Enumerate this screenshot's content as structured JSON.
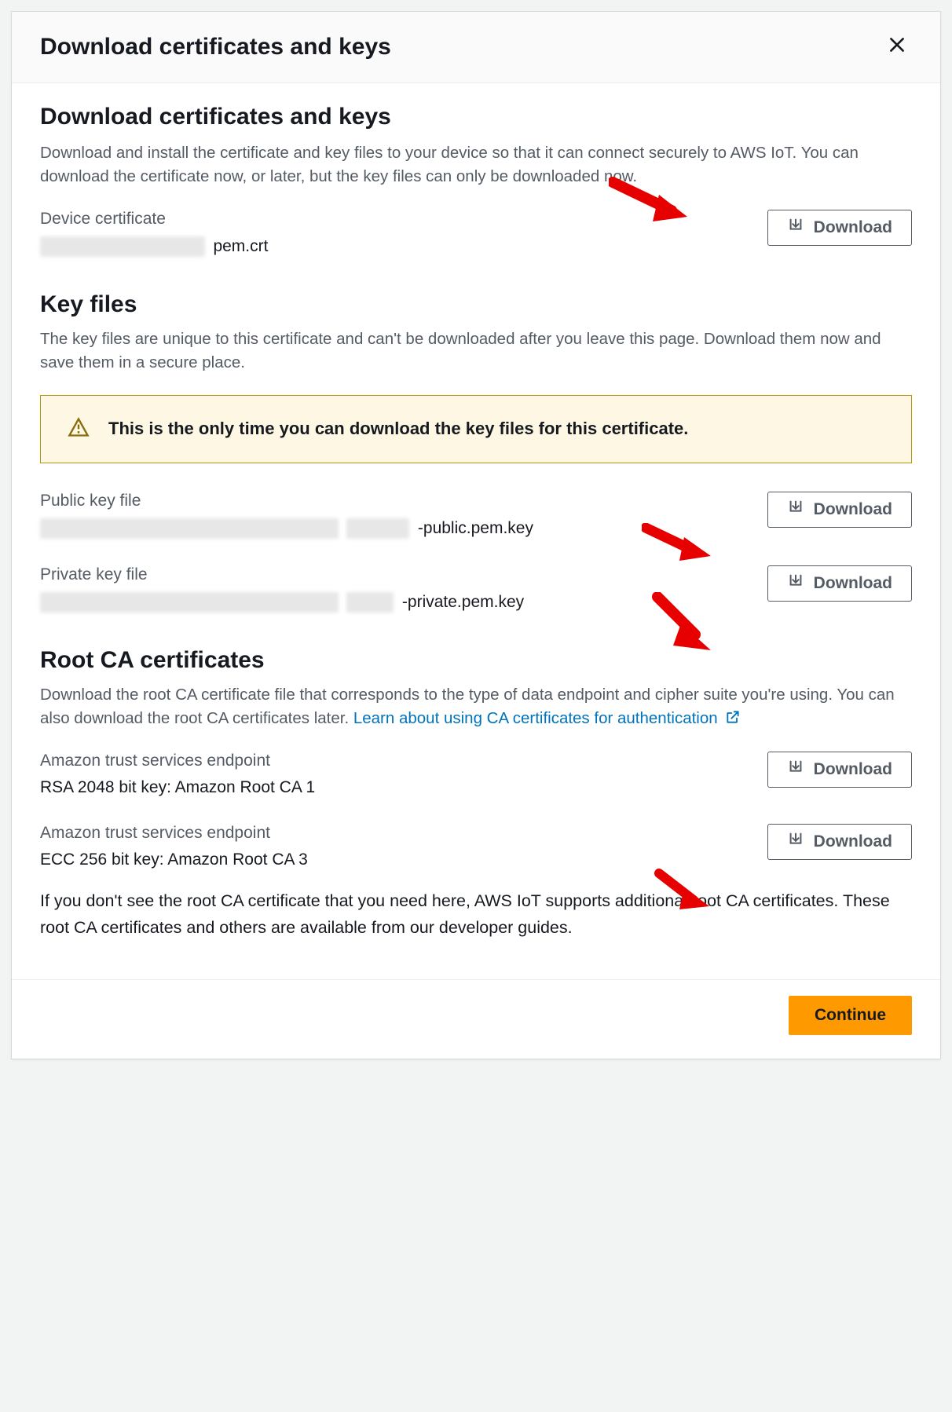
{
  "modal": {
    "title": "Download certificates and keys"
  },
  "section1": {
    "title": "Download certificates and keys",
    "desc": "Download and install the certificate and key files to your device so that it can connect securely to AWS IoT. You can download the certificate now, or later, but the key files can only be downloaded now.",
    "device_cert_label": "Device certificate",
    "device_cert_suffix": "pem.crt",
    "download_btn": "Download"
  },
  "section2": {
    "title": "Key files",
    "desc": "The key files are unique to this certificate and can't be downloaded after you leave this page. Download them now and save them in a secure place.",
    "alert": "This is the only time you can download the key files for this certificate.",
    "public_label": "Public key file",
    "public_suffix": "-public.pem.key",
    "private_label": "Private key file",
    "private_suffix": "-private.pem.key",
    "download_btn": "Download"
  },
  "section3": {
    "title": "Root CA certificates",
    "desc_pre": "Download the root CA certificate file that corresponds to the type of data endpoint and cipher suite you're using. You can also download the root CA certificates later. ",
    "link_text": "Learn about using CA certificates for authentication",
    "ca1_label": "Amazon trust services endpoint",
    "ca1_value": "RSA 2048 bit key: Amazon Root CA 1",
    "ca2_label": "Amazon trust services endpoint",
    "ca2_value": "ECC 256 bit key: Amazon Root CA 3",
    "download_btn": "Download",
    "footnote": "If you don't see the root CA certificate that you need here, AWS IoT supports additional root CA certificates. These root CA certificates and others are available from our developer guides."
  },
  "footer": {
    "continue": "Continue"
  }
}
